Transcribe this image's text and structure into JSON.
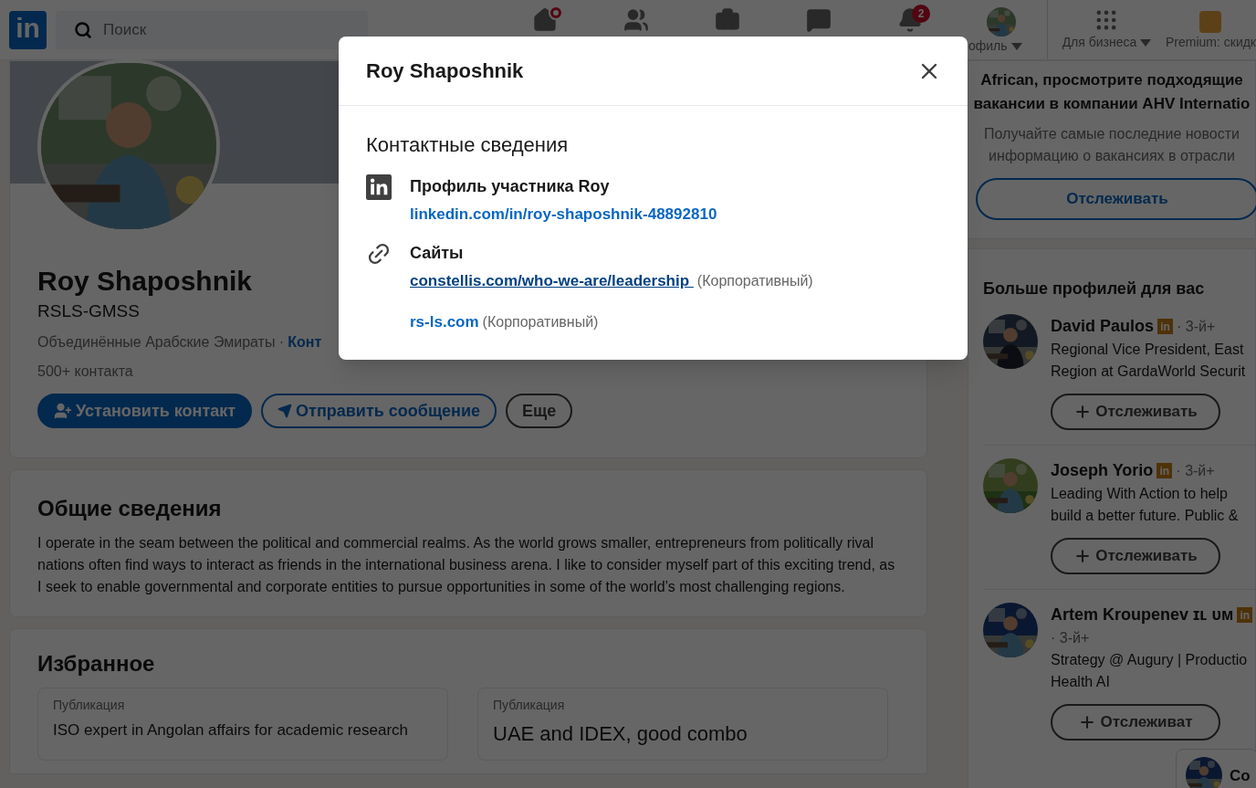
{
  "nav": {
    "logo": "in",
    "search": {
      "placeholder": "Поиск"
    },
    "items": [
      {
        "kind": "home",
        "badge_dot": true
      },
      {
        "kind": "people"
      },
      {
        "kind": "jobs"
      },
      {
        "kind": "messages"
      },
      {
        "kind": "bell",
        "badge": "2"
      },
      {
        "kind": "profile",
        "label": "офиль"
      },
      {
        "kind": "apps",
        "label": "Для бизнеса"
      },
      {
        "kind": "premium",
        "label": "Premium: скидк"
      }
    ]
  },
  "profile": {
    "name": "Roy Shaposhnik",
    "headline": "RSLS-GMSS",
    "location": "Объединённые Арабские Эмираты ·",
    "contact_link": "Конт",
    "connections": "500+ контакта",
    "buttons": [
      {
        "kind": "primary",
        "label": "Установить контакт"
      },
      {
        "kind": "outline",
        "label": "Отправить сообщение"
      },
      {
        "kind": "secondary",
        "label": "Еще"
      }
    ]
  },
  "about": {
    "title": "Общие сведения",
    "text": "I operate in the seam between the political and commercial realms. As the world grows smaller, entrepreneurs from politically rival nations often find ways to interact as friends in the international business arena. I like to consider myself part of this exciting trend, as I seek to enable governmental and corporate entities to pursue opportunities in some of the world’s most challenging regions."
  },
  "featured": {
    "title": "Избранное",
    "items": [
      {
        "type": "Публикация",
        "title": "ISO expert in Angolan affairs for academic research"
      },
      {
        "type": "Публикация",
        "title": "UAE and IDEX, good combo"
      }
    ]
  },
  "sidebar": {
    "promo": {
      "lines": [
        "African, просмотрите подходящие",
        "вакансии в компании AHV Internatio"
      ],
      "subtext": [
        "Получайте самые последние новости",
        "информацию о вакансиях в отрасли"
      ],
      "button": "Отслеживать"
    },
    "people_title": "Больше профилей для вас",
    "people": [
      {
        "name": "David Paulos",
        "badge": "in",
        "degree": "· 3-й+",
        "headline": [
          "Regional Vice President, East",
          "Region at GardaWorld Securit"
        ],
        "button": "Отслеживать"
      },
      {
        "name": "Joseph Yorio",
        "badge": "in",
        "degree": "· 3-й+",
        "headline": [
          "Leading With Action to help",
          "build a better future. Public &"
        ],
        "button": "Отслеживать"
      },
      {
        "name": "Artem Kroupenev ɪʟ ᴜᴍ",
        "badge": "in",
        "degree": "· 3-й+",
        "headline": [
          "Strategy @ Augury | Productio",
          "Health AI"
        ],
        "button": "Отслеживат"
      }
    ],
    "messaging": {
      "label": "Co"
    }
  },
  "modal": {
    "title": "Roy Shaposhnik",
    "heading": "Контактные сведения",
    "sections": [
      {
        "kind": "profile",
        "label": "Профиль участника Roy",
        "links": [
          {
            "url": "linkedin.com/in/roy-shaposhnik-48892810",
            "underlined": false
          }
        ]
      },
      {
        "kind": "websites",
        "label": "Сайты",
        "links": [
          {
            "url": "constellis.com/who-we-are/leadership ",
            "note": "(Корпоративный)",
            "underlined": true
          },
          {
            "url": "rs-ls.com",
            "note": "(Корпоративный)",
            "underlined": false
          }
        ]
      }
    ]
  }
}
